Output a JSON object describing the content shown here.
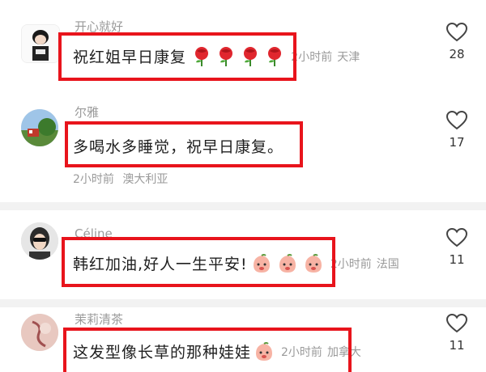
{
  "comments": [
    {
      "username": "开心就好",
      "content": "祝红姐早日康复",
      "emoji": "rose",
      "emoji_count": 4,
      "time": "2小时前",
      "location": "天津",
      "likes": "28"
    },
    {
      "username": "尔雅",
      "content": "多喝水多睡觉，祝早日康复。",
      "time": "2小时前",
      "location": "澳大利亚",
      "likes": "17"
    },
    {
      "username": "Céline",
      "content": "韩红加油,好人一生平安!",
      "emoji": "peach-face",
      "emoji_count": 3,
      "time": "2小时前",
      "location": "法国",
      "likes": "11"
    },
    {
      "username": "茉莉清茶",
      "content": "这发型像长草的那种娃娃",
      "emoji": "peach-face",
      "emoji_count": 1,
      "time": "2小时前",
      "location": "加拿大",
      "likes": "11"
    }
  ],
  "colors": {
    "highlight": "#e8141c",
    "meta": "#9a9a9a",
    "text": "#1f1f1f"
  },
  "icons": {
    "like": "heart-outline-icon"
  }
}
